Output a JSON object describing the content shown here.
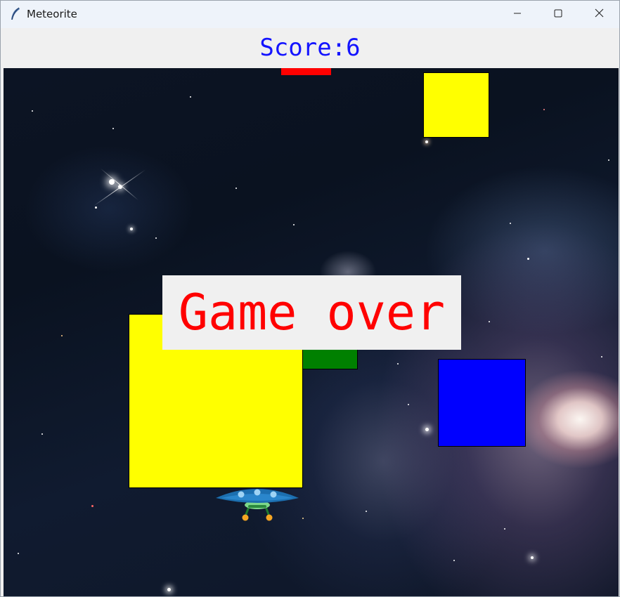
{
  "window": {
    "title": "Meteorite",
    "icons": {
      "app": "feather-icon",
      "minimize": "minimize-icon",
      "maximize": "maximize-icon",
      "close": "close-icon"
    }
  },
  "score": {
    "text": "Score:6"
  },
  "game": {
    "message": "Game over",
    "colors": {
      "score_text": "#1414ff",
      "message_text": "#ff0000",
      "meteors": [
        "#ff0000",
        "#ffff00",
        "#ffff00",
        "#008000",
        "#0000ff"
      ]
    },
    "player": "ufo-spaceship"
  }
}
